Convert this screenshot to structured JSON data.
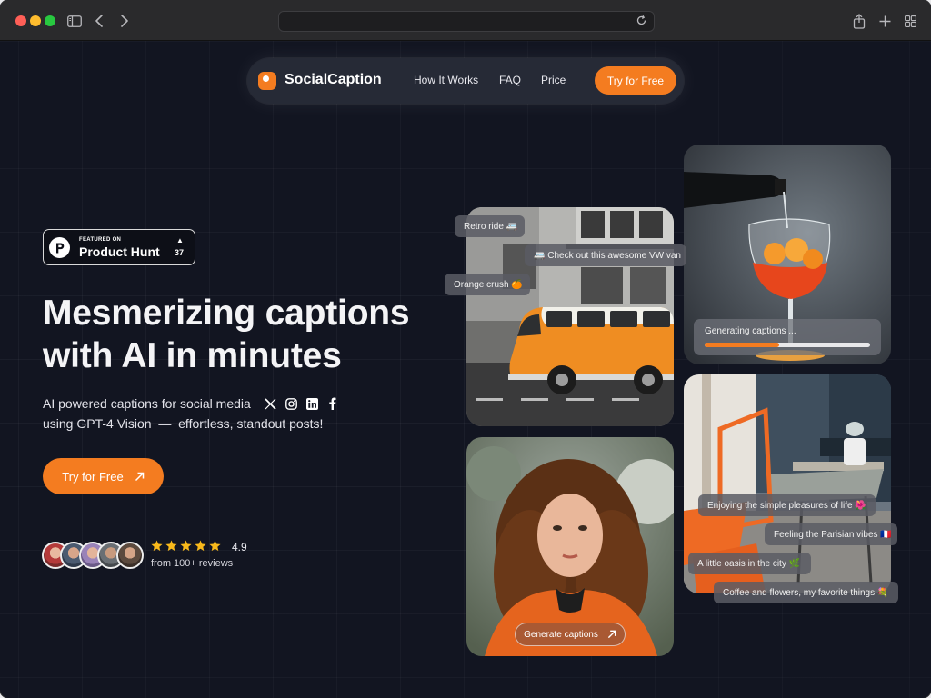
{
  "browser": {
    "address_text": "",
    "icons": [
      "sidebar-icon",
      "back-icon",
      "forward-icon",
      "reload-icon",
      "share-icon",
      "new-tab-icon",
      "tab-overview-icon"
    ]
  },
  "nav": {
    "brand": "SocialCaption",
    "links": [
      "How It Works",
      "FAQ",
      "Price"
    ],
    "cta": "Try for Free"
  },
  "product_hunt": {
    "small": "FEATURED ON",
    "big": "Product Hunt",
    "upvotes": "37"
  },
  "hero": {
    "headline_line1": "Mesmerizing captions",
    "headline_line2": "with AI in minutes",
    "subtitle_line1": "AI powered captions for social media",
    "subtitle_line2": "using GPT-4 Vision  —  effortless, standout posts!",
    "social_icons": [
      "x-icon",
      "instagram-icon",
      "linkedin-icon",
      "facebook-icon"
    ],
    "cta": "Try for Free"
  },
  "social_proof": {
    "avatar_count": 5,
    "stars": 5,
    "rating": "4.9",
    "reviews": "from 100+ reviews"
  },
  "cards": {
    "van_captions": [
      "Retro ride 🚐",
      "🚐 Check out this awesome VW van",
      "Orange crush 🍊"
    ],
    "drink_status": "Generating captions ...",
    "drink_progress": 0.45,
    "girl_button": "Generate captions",
    "cafe_captions": [
      "Enjoying the simple pleasures of life 🌺",
      "Feeling the Parisian vibes 🇫🇷",
      "A little oasis in the city 🌿",
      "Coffee and flowers, my favorite things 💐"
    ]
  },
  "colors": {
    "accent": "#f47c20",
    "background": "#121521",
    "nav_bg": "#262a36"
  }
}
